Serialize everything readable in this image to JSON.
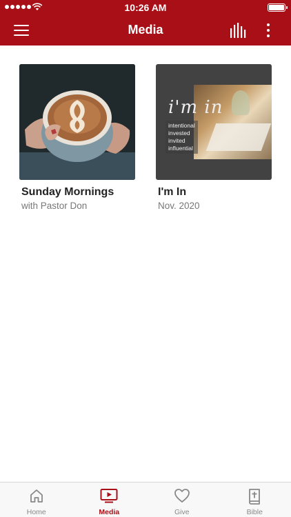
{
  "status_bar": {
    "time": "10:26 AM"
  },
  "nav": {
    "title": "Media"
  },
  "cards": [
    {
      "title": "Sunday Mornings",
      "subtitle": "with Pastor Don",
      "image": "latte-art-coffee-cup"
    },
    {
      "title": "I'm In",
      "subtitle": "Nov. 2020",
      "image": "im-in-series-graphic",
      "graphic": {
        "logo": "i'm in",
        "words": [
          "intentional",
          "invested",
          "invited",
          "influential"
        ]
      }
    }
  ],
  "tabs": [
    {
      "label": "Home",
      "icon": "home-icon",
      "active": false
    },
    {
      "label": "Media",
      "icon": "play-icon",
      "active": true
    },
    {
      "label": "Give",
      "icon": "heart-icon",
      "active": false
    },
    {
      "label": "Bible",
      "icon": "bible-icon",
      "active": false
    }
  ],
  "colors": {
    "brand": "#a80f16",
    "tab_inactive": "#888888"
  }
}
